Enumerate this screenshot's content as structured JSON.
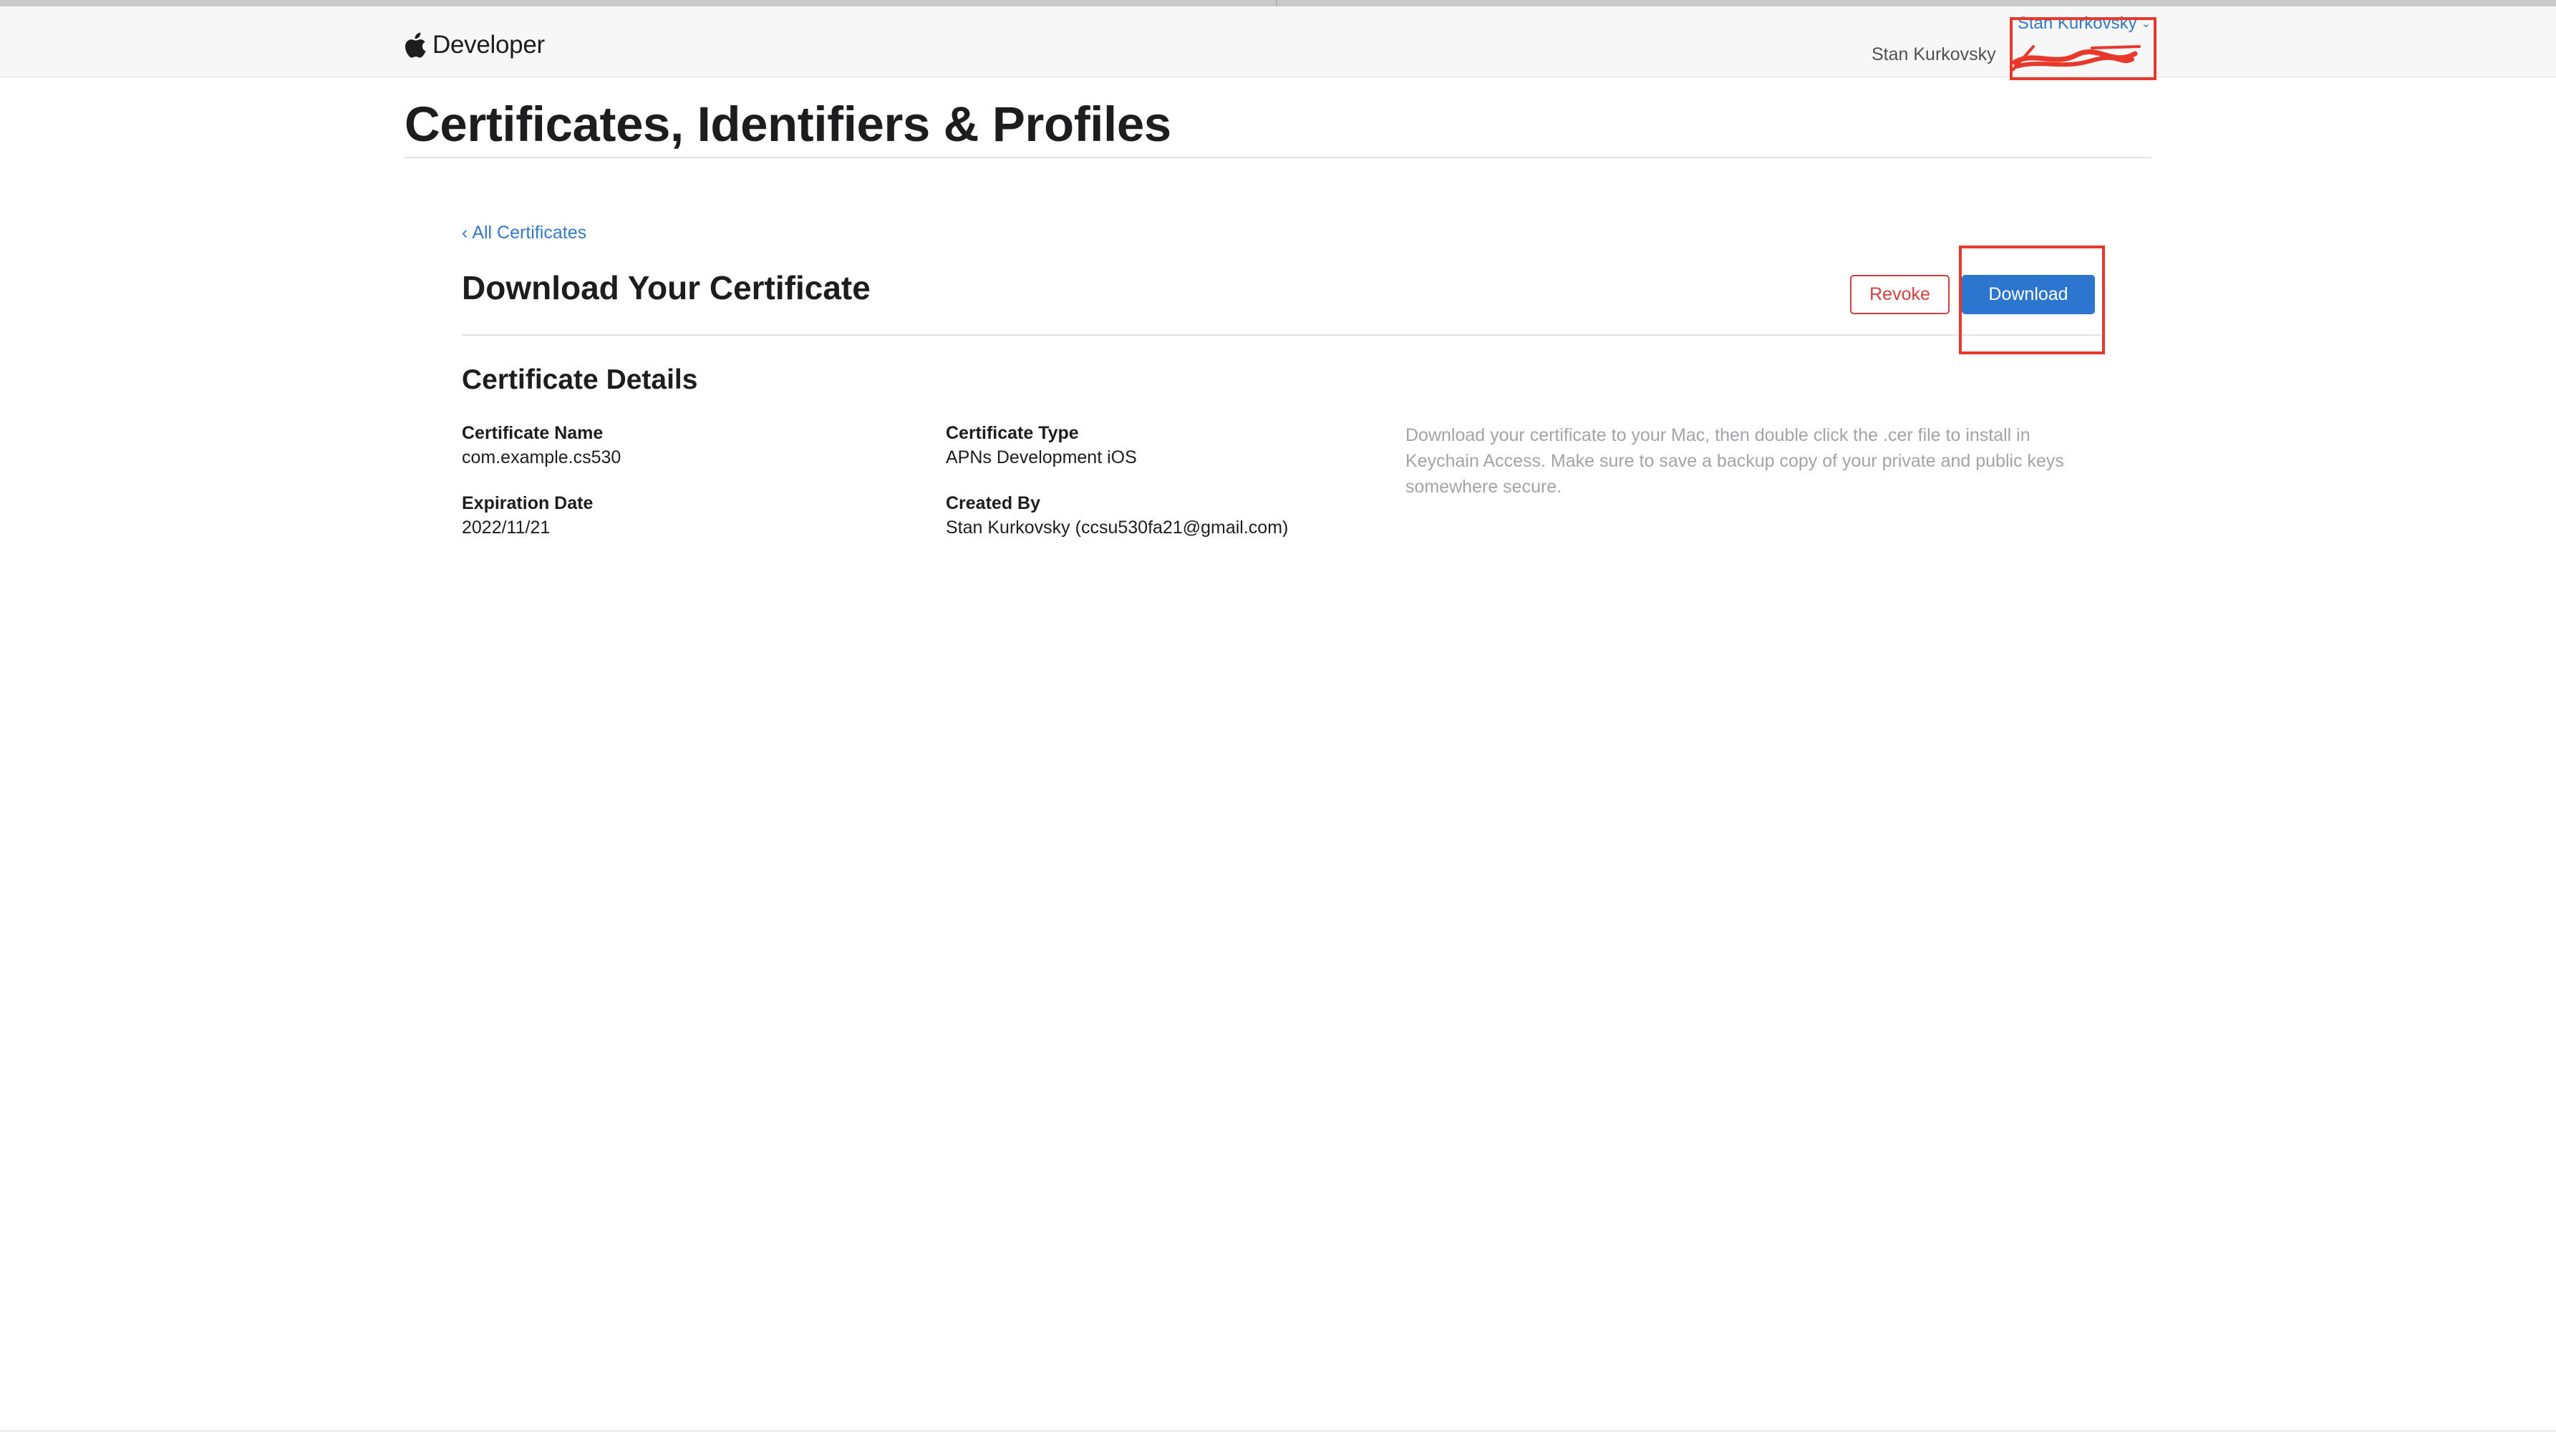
{
  "header": {
    "brand_label": "Developer",
    "account_name": "Stan Kurkovsky",
    "team_name": "Stan Kurkovsky"
  },
  "page": {
    "title": "Certificates, Identifiers & Profiles"
  },
  "back_link": {
    "chevron": "‹",
    "label": "All Certificates"
  },
  "section": {
    "title": "Download Your Certificate",
    "revoke_label": "Revoke",
    "download_label": "Download"
  },
  "details": {
    "title": "Certificate Details",
    "name_label": "Certificate Name",
    "name_value": "com.example.cs530",
    "type_label": "Certificate Type",
    "type_value": "APNs Development iOS",
    "expiration_label": "Expiration Date",
    "expiration_value": "2022/11/21",
    "created_by_label": "Created By",
    "created_by_value": "Stan Kurkovsky (ccsu530fa21@gmail.com)",
    "help_text": "Download your certificate to your Mac, then double click the .cer file to install in Keychain Access. Make sure to save a backup copy of your private and public keys somewhere secure."
  },
  "icons": {
    "brand": "apple-logo-icon",
    "account_menu": "chevron-down-icon",
    "back": "chevron-left-icon"
  },
  "colors": {
    "link": "#3478c6",
    "primary_button": "#2d76cf",
    "destructive": "#d13f3f",
    "annotation": "#e8382b",
    "muted_text": "#a3a3a8"
  }
}
